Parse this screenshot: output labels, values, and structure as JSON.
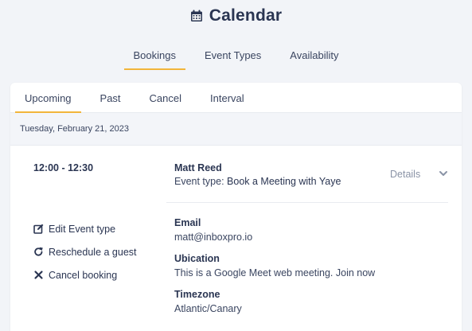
{
  "header": {
    "title": "Calendar",
    "icon": "calendar-icon"
  },
  "main_tabs": [
    {
      "label": "Bookings",
      "active": true
    },
    {
      "label": "Event Types",
      "active": false
    },
    {
      "label": "Availability",
      "active": false
    }
  ],
  "sub_tabs": [
    {
      "label": "Upcoming",
      "active": true
    },
    {
      "label": "Past",
      "active": false
    },
    {
      "label": "Cancel",
      "active": false
    },
    {
      "label": "Interval",
      "active": false
    }
  ],
  "booking": {
    "date": "Tuesday, February 21, 2023",
    "time": "12:00 - 12:30",
    "guest_name": "Matt Reed",
    "event_type_label": "Event type:",
    "event_type_value": "Book a Meeting with Yaye",
    "details_label": "Details",
    "actions": [
      {
        "label": "Edit Event type",
        "icon": "edit-icon"
      },
      {
        "label": "Reschedule a guest",
        "icon": "redo-icon"
      },
      {
        "label": "Cancel booking",
        "icon": "close-icon"
      }
    ],
    "info": [
      {
        "label": "Email",
        "value": "matt@inboxpro.io"
      },
      {
        "label": "Ubication",
        "value": "This is a Google Meet web meeting. Join now"
      },
      {
        "label": "Timezone",
        "value": "Atlantic/Canary"
      }
    ]
  },
  "colors": {
    "accent": "#f2b53a",
    "text": "#2a3552",
    "background": "#f2f4f8"
  }
}
